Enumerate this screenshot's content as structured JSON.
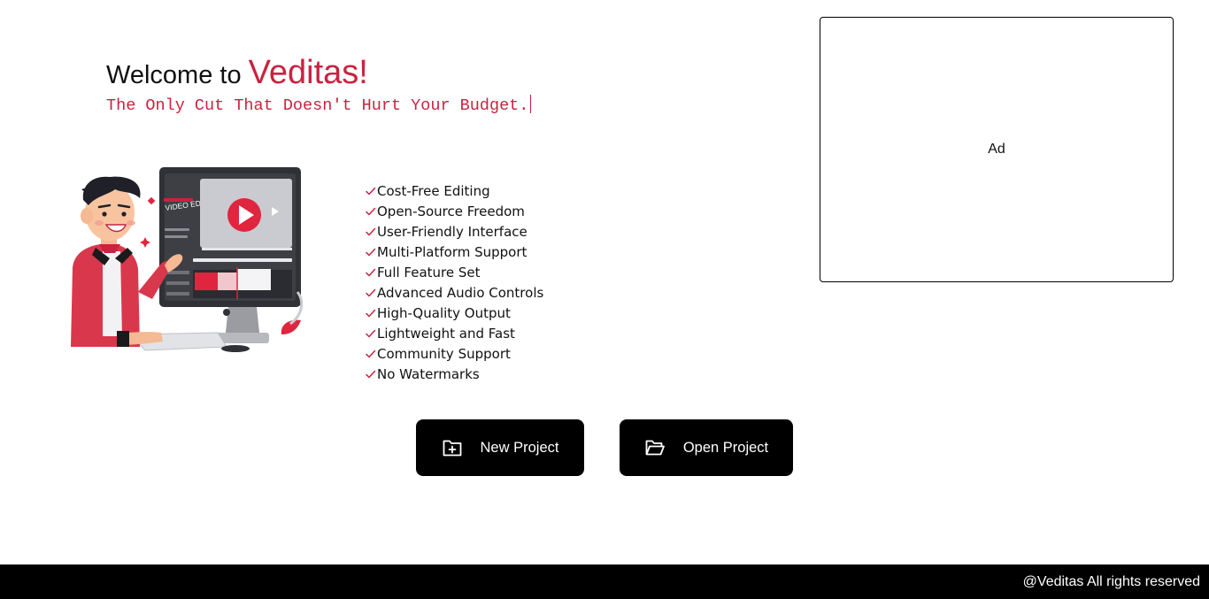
{
  "hero": {
    "welcome_prefix": "Welcome to ",
    "brand_name": "Veditas!",
    "tagline": "The Only Cut That Doesn't Hurt Your Budget.",
    "illustration_label": "VIDEO EDITING"
  },
  "features": [
    "Cost-Free Editing",
    "Open-Source Freedom",
    "User-Friendly Interface",
    "Multi-Platform Support",
    "Full Feature Set",
    "Advanced Audio Controls",
    "High-Quality Output",
    "Lightweight and Fast",
    "Community Support",
    "No Watermarks"
  ],
  "actions": {
    "new_project_label": "New Project",
    "new_project_icon": "folder-plus-icon",
    "open_project_label": "Open Project",
    "open_project_icon": "folder-open-icon"
  },
  "ad": {
    "label": "Ad"
  },
  "footer": {
    "text": "@Veditas All rights reserved"
  },
  "colors": {
    "brand": "#c9233f",
    "button_bg": "#000000",
    "footer_bg": "#000000",
    "text": "#111111"
  }
}
